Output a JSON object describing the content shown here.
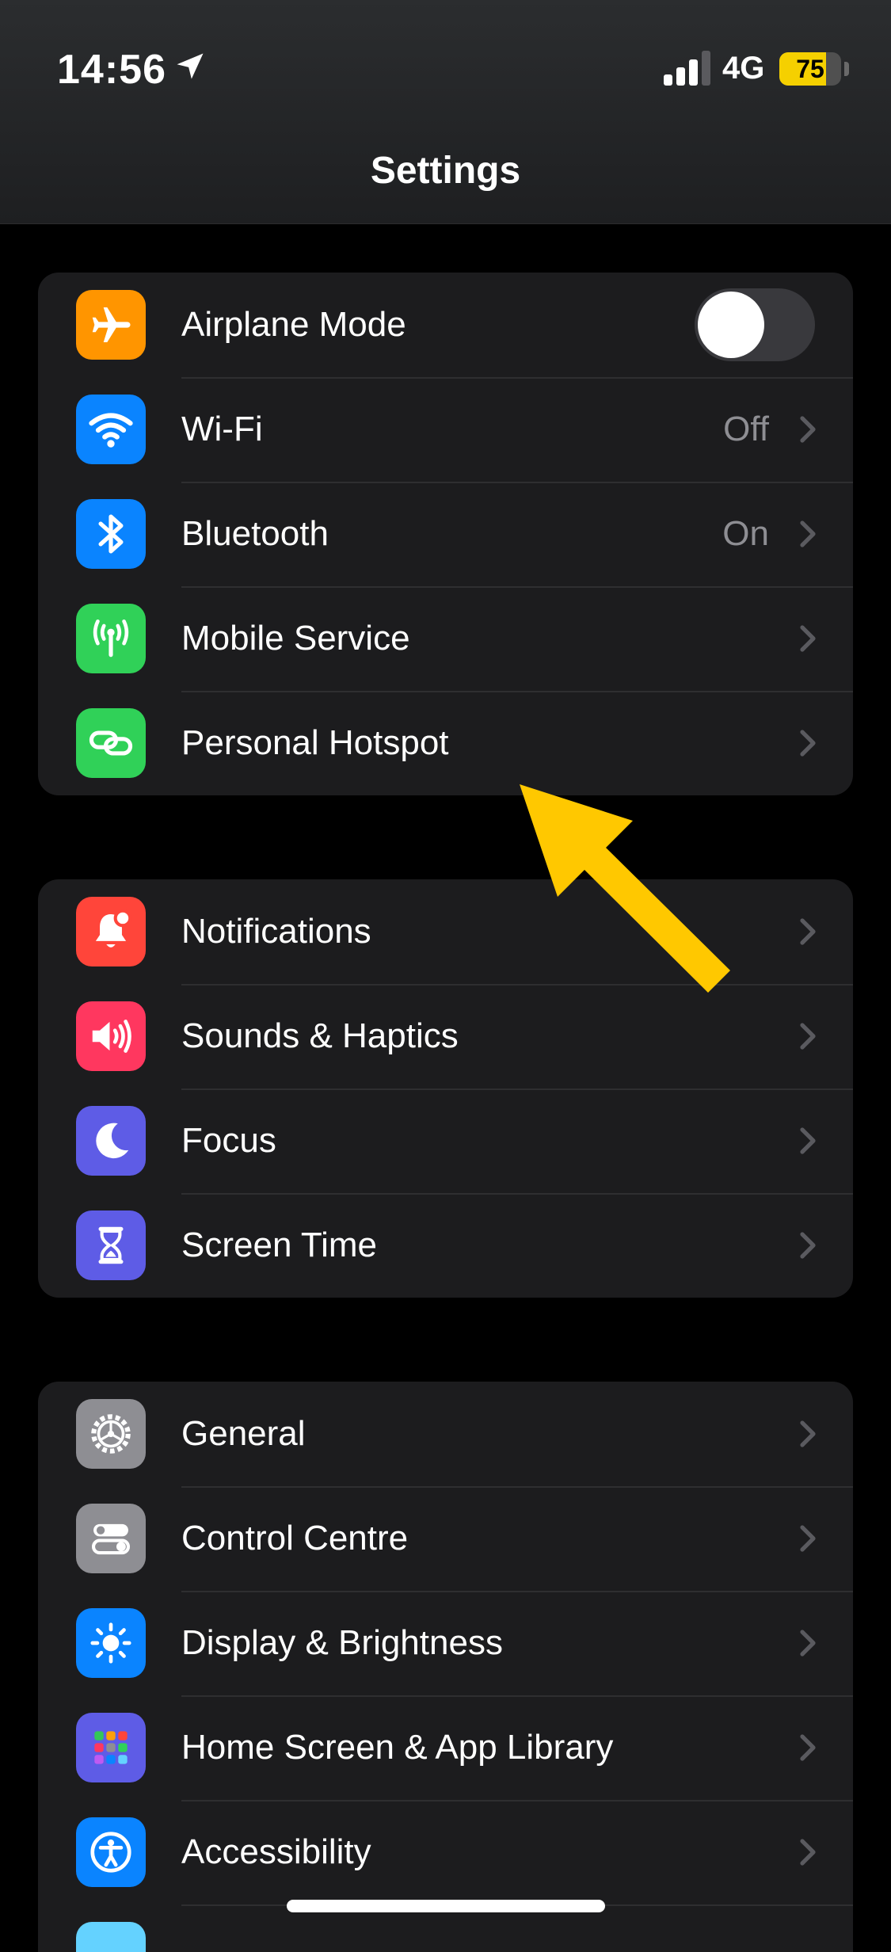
{
  "status_bar": {
    "time": "14:56",
    "network": "4G",
    "battery_percent": 75
  },
  "page_title": "Settings",
  "groups": [
    [
      {
        "label": "Airplane Mode",
        "icon": "airplane-icon",
        "icon_color": "#ff9500",
        "control": "toggle",
        "toggle_on": false
      },
      {
        "label": "Wi-Fi",
        "icon": "wifi-icon",
        "icon_color": "#0a84ff",
        "value": "Off"
      },
      {
        "label": "Bluetooth",
        "icon": "bluetooth-icon",
        "icon_color": "#0a84ff",
        "value": "On"
      },
      {
        "label": "Mobile Service",
        "icon": "antenna-icon",
        "icon_color": "#30d158"
      },
      {
        "label": "Personal Hotspot",
        "icon": "hotspot-link-icon",
        "icon_color": "#30d158"
      }
    ],
    [
      {
        "label": "Notifications",
        "icon": "bell-icon",
        "icon_color": "#ff453a"
      },
      {
        "label": "Sounds & Haptics",
        "icon": "speaker-icon",
        "icon_color": "#ff375f"
      },
      {
        "label": "Focus",
        "icon": "moon-icon",
        "icon_color": "#5e5ce6"
      },
      {
        "label": "Screen Time",
        "icon": "hourglass-icon",
        "icon_color": "#5e5ce6"
      }
    ],
    [
      {
        "label": "General",
        "icon": "gear-icon",
        "icon_color": "#8e8e93"
      },
      {
        "label": "Control Centre",
        "icon": "switches-icon",
        "icon_color": "#8e8e93"
      },
      {
        "label": "Display & Brightness",
        "icon": "sun-icon",
        "icon_color": "#0a84ff"
      },
      {
        "label": "Home Screen & App Library",
        "icon": "app-grid-icon",
        "icon_color": "#5e5ce6"
      },
      {
        "label": "Accessibility",
        "icon": "accessibility-icon",
        "icon_color": "#0a84ff"
      }
    ]
  ],
  "annotation": {
    "color": "#ffc800",
    "icon": "arrow-pointer-icon"
  }
}
